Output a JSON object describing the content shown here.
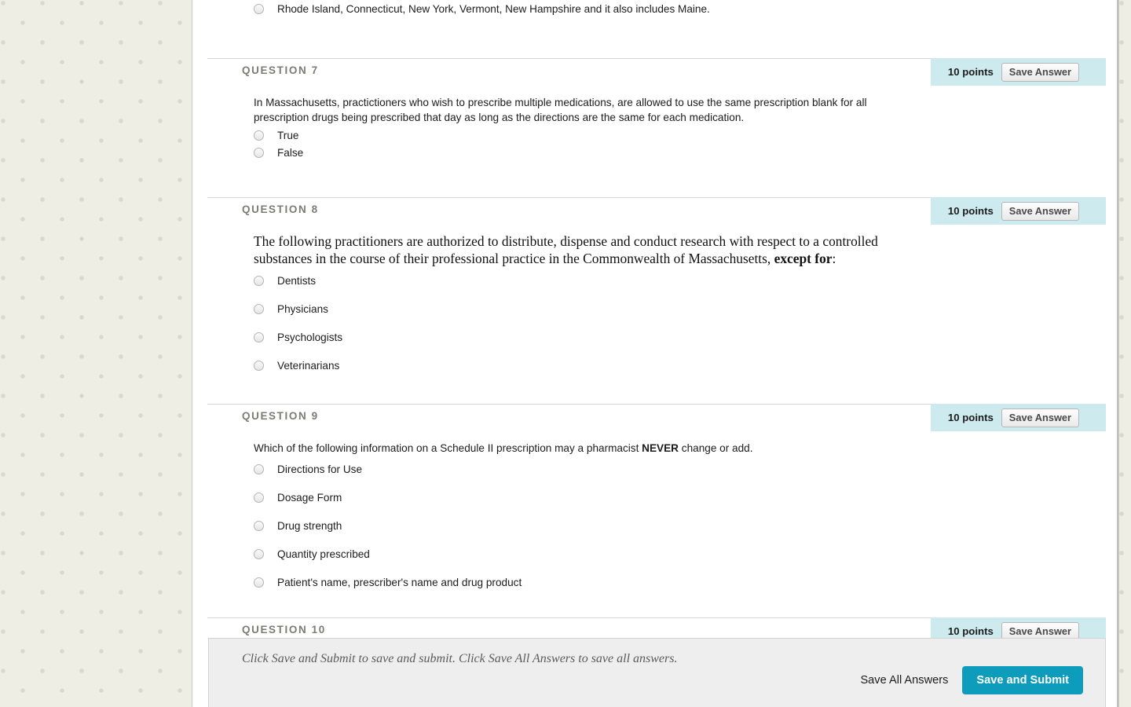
{
  "colors": {
    "points_band_bg": "#cdeaef",
    "submit_button_bg": "#0e9cbc",
    "page_pattern_bg": "#eeeee4",
    "question_header_text": "#7b7b77",
    "bottom_bar_bg": "#eeeeee"
  },
  "top_partial_option": {
    "label": "Rhode Island, Connecticut, New York, Vermont, New Hampshire and it also includes Maine."
  },
  "questions": [
    {
      "header": "QUESTION 7",
      "points": "10 points",
      "save_label": "Save Answer",
      "font": "sans",
      "prompt": "In Massachusetts, practictioners who wish to prescribe multiple medications, are allowed to use the same prescription blank for all prescription drugs being prescribed that day as long as the directions are the same for each medication.",
      "options": [
        "True",
        "False"
      ]
    },
    {
      "header": "QUESTION 8",
      "points": "10 points",
      "save_label": "Save Answer",
      "font": "serif",
      "prompt_pre": "The following practitioners are authorized to distribute, dispense and conduct research with respect to a controlled substances in the course of their professional practice in the Commonwealth of Massachusetts, ",
      "prompt_bold": "except for",
      "prompt_post": ":",
      "options": [
        "Dentists",
        "Physicians",
        "Psychologists",
        "Veterinarians"
      ]
    },
    {
      "header": "QUESTION 9",
      "points": "10 points",
      "save_label": "Save Answer",
      "font": "sans",
      "prompt_pre": "Which of the following information on a Schedule II prescription may a pharmacist ",
      "prompt_bold": "NEVER",
      "prompt_post": " change or add.",
      "options": [
        "Directions for Use",
        "Dosage Form",
        "Drug strength",
        "Quantity prescribed",
        "Patient's name, prescriber's name and drug product"
      ]
    },
    {
      "header": "QUESTION 10",
      "points": "10 points",
      "save_label": "Save Answer"
    }
  ],
  "submit_bar": {
    "hint": "Click Save and Submit to save and submit. Click Save All Answers to save all answers.",
    "save_all_label": "Save All Answers",
    "save_submit_label": "Save and Submit"
  }
}
